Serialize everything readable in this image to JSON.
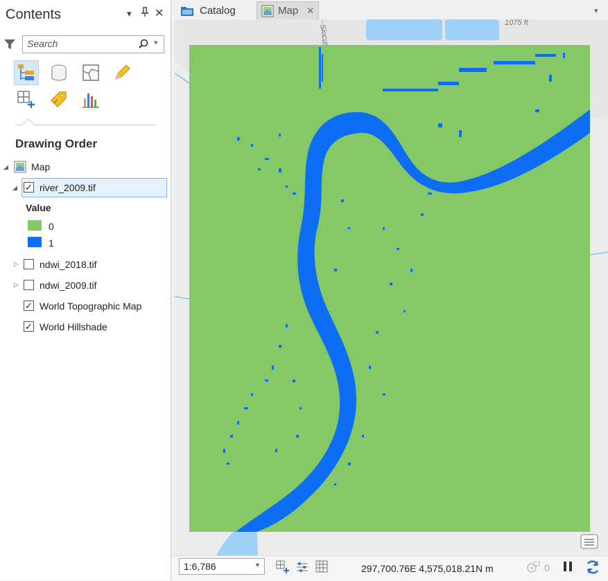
{
  "contents": {
    "title": "Contents",
    "search": {
      "placeholder": "Search"
    },
    "section_title": "Drawing Order",
    "map_node": {
      "label": "Map"
    },
    "layers": [
      {
        "name": "river_2009.tif",
        "checked": true,
        "expanded": true,
        "selected": true
      },
      {
        "name": "ndwi_2018.tif",
        "checked": false,
        "expanded": false
      },
      {
        "name": "ndwi_2009.tif",
        "checked": false,
        "expanded": false
      },
      {
        "name": "World Topographic Map",
        "checked": true
      },
      {
        "name": "World Hillshade",
        "checked": true
      }
    ],
    "legend": {
      "heading": "Value",
      "items": [
        {
          "label": "0",
          "color": "#85c966"
        },
        {
          "label": "1",
          "color": "#0d6ef5"
        }
      ]
    }
  },
  "tabs": [
    {
      "label": "Catalog",
      "icon": "catalog-icon",
      "active": false
    },
    {
      "label": "Map",
      "icon": "map-icon",
      "active": true
    }
  ],
  "map": {
    "basemap_labels": {
      "road": "Slocum",
      "elevation": "1075 ft"
    },
    "colors": {
      "land": "#85c966",
      "water": "#0d6ef5",
      "basemap_water": "#9fd1f7",
      "basemap_bg": "#ececec"
    }
  },
  "status": {
    "scale": "1:6,786",
    "coordinates": "297,700.76E 4,575,018.21N m",
    "selected_count": "0"
  }
}
